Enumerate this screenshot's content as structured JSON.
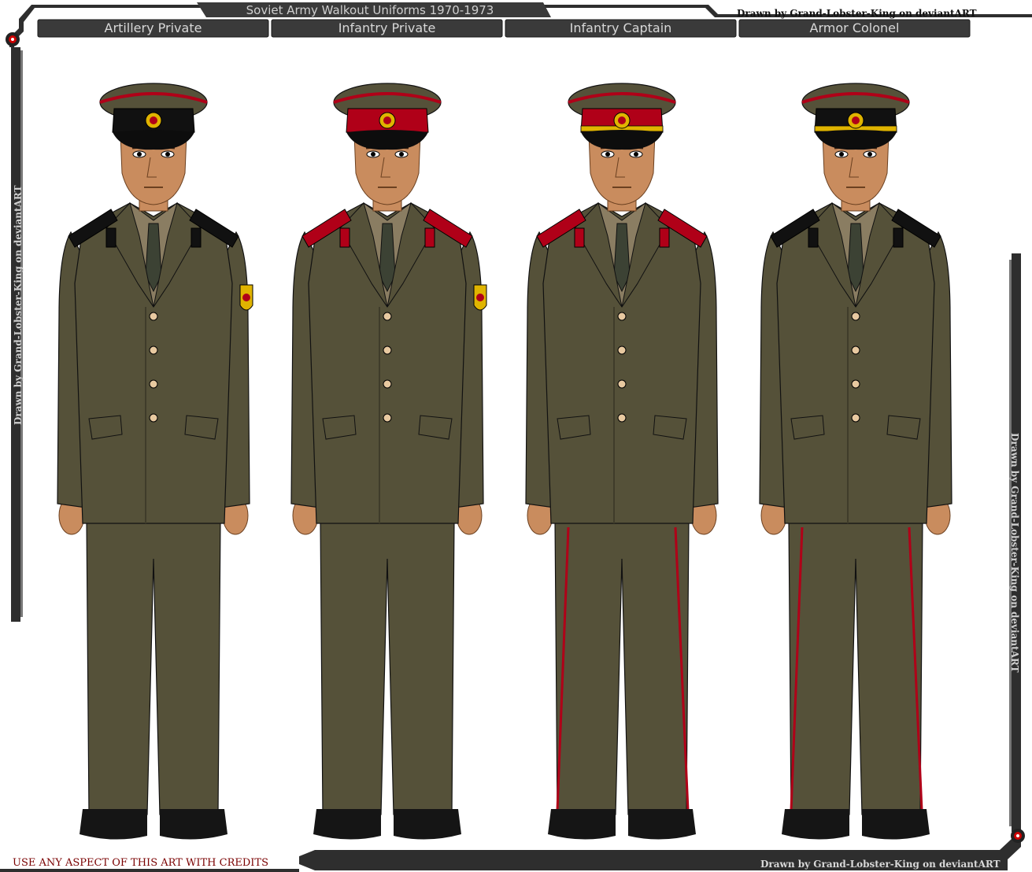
{
  "header": {
    "title": "Soviet Army Walkout Uniforms 1970-1973",
    "credit": "Drawn by Grand-Lobster-King on deviantART"
  },
  "labels": [
    {
      "text": "Artillery Private"
    },
    {
      "text": "Infantry Private"
    },
    {
      "text": "Infantry Captain"
    },
    {
      "text": "Armor Colonel"
    }
  ],
  "side_credit_left": "Drawn by Grand-Lobster-King on deviantART",
  "side_credit_right": "Drawn by Grand-Lobster-King on deviantART",
  "footer": {
    "usage_note": "USE ANY ASPECT OF THIS ART WITH CREDITS",
    "credit": "Drawn by Grand-Lobster-King on deviantART"
  },
  "figures": [
    {
      "band": "black",
      "shoulder": "black",
      "piping": false,
      "sleeve_patch": true,
      "cap_trim": "none",
      "insignia": "red"
    },
    {
      "band": "red",
      "shoulder": "red",
      "piping": false,
      "sleeve_patch": true,
      "cap_trim": "none",
      "insignia": "red"
    },
    {
      "band": "red",
      "shoulder": "red",
      "piping": true,
      "sleeve_patch": false,
      "cap_trim": "gold",
      "insignia": "red"
    },
    {
      "band": "black",
      "shoulder": "black",
      "piping": true,
      "sleeve_patch": false,
      "cap_trim": "gold",
      "insignia": "red"
    }
  ],
  "colors": {
    "frame": "#2e2e2e",
    "uniform": "#555139",
    "uniform_shadow": "#3f3c2a",
    "shirt": "#8a7d62",
    "tie": "#3c4234",
    "skin": "#c98c5e",
    "red": "#b00018",
    "black": "#111111",
    "gold": "#e0b400",
    "button": "#e8c9a0",
    "boot": "#151515"
  }
}
